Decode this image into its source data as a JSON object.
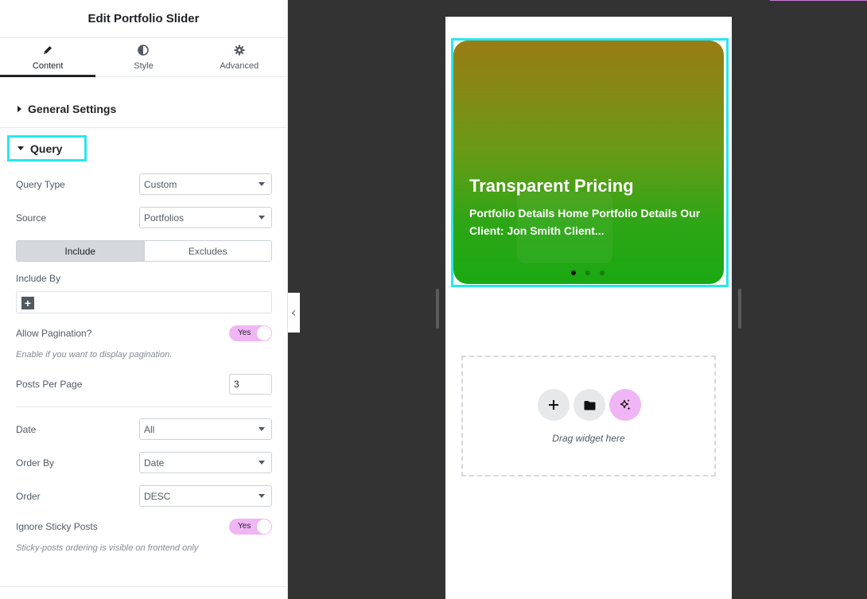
{
  "panel": {
    "title": "Edit Portfolio Slider",
    "tabs": [
      {
        "label": "Content",
        "icon": "pencil-icon"
      },
      {
        "label": "Style",
        "icon": "half-circle-icon"
      },
      {
        "label": "Advanced",
        "icon": "gear-icon"
      }
    ],
    "general_settings": "General Settings",
    "query_section": "Query",
    "fields": {
      "query_type": {
        "label": "Query Type",
        "value": "Custom"
      },
      "source": {
        "label": "Source",
        "value": "Portfolios"
      },
      "include_tab": "Include",
      "excludes_tab": "Excludes",
      "include_by": {
        "label": "Include By"
      },
      "allow_pagination": {
        "label": "Allow Pagination?",
        "value": "Yes",
        "help": "Enable if you want to display pagination."
      },
      "posts_per_page": {
        "label": "Posts Per Page",
        "value": "3"
      },
      "date": {
        "label": "Date",
        "value": "All"
      },
      "order_by": {
        "label": "Order By",
        "value": "Date"
      },
      "order": {
        "label": "Order",
        "value": "DESC"
      },
      "ignore_sticky": {
        "label": "Ignore Sticky Posts",
        "value": "Yes",
        "help": "Sticky-posts ordering is visible on frontend only"
      }
    }
  },
  "preview": {
    "slide": {
      "title": "Transparent Pricing",
      "description": "Portfolio Details Home Portfolio Details Our Client: Jon Smith Client...",
      "dots_count": 3,
      "active_dot": 1
    },
    "drop_zone": {
      "text": "Drag widget here",
      "buttons": [
        "plus-icon",
        "folder-icon",
        "sparkle-icon"
      ]
    }
  },
  "colors": {
    "highlight": "#26e7ef",
    "toggle_on": "#f0b5f5",
    "canvas_bg": "#333333"
  }
}
